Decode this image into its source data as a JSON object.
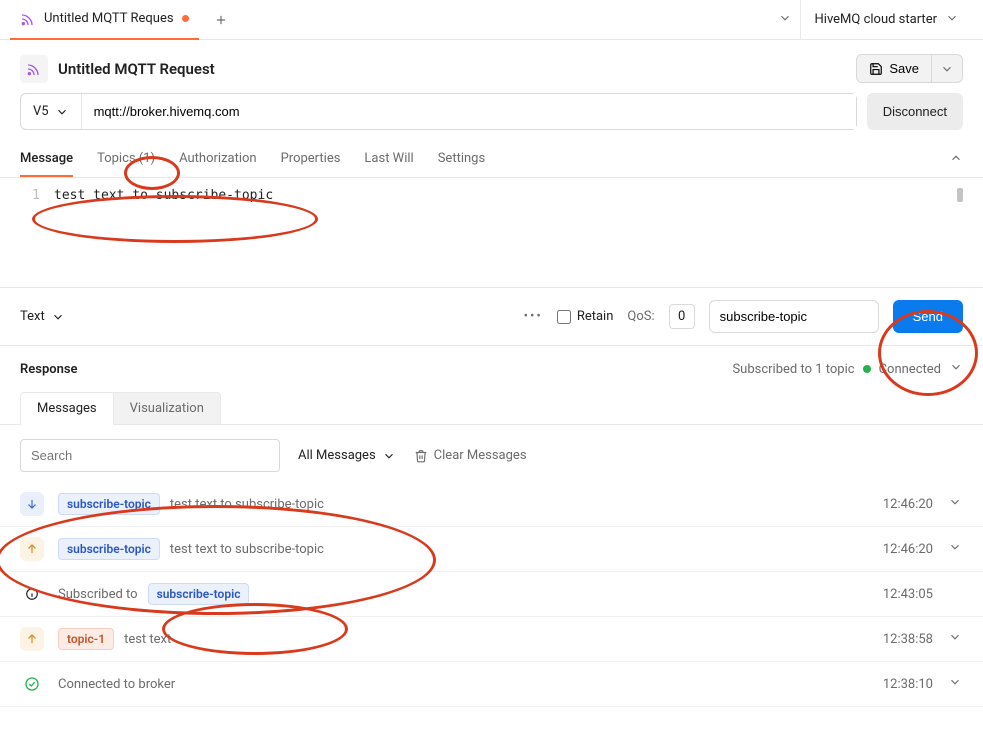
{
  "tabbar": {
    "tab_title": "Untitled MQTT Reques",
    "env_name": "HiveMQ cloud starter"
  },
  "request": {
    "title": "Untitled MQTT Request",
    "save_label": "Save",
    "version_label": "V5",
    "url": "mqtt://broker.hivemq.com",
    "disconnect_label": "Disconnect"
  },
  "req_tabs": {
    "message": "Message",
    "topics": "Topics (1)",
    "authorization": "Authorization",
    "properties": "Properties",
    "last_will": "Last Will",
    "settings": "Settings"
  },
  "editor": {
    "line_number": "1",
    "content": "test text to subscribe-topic"
  },
  "send_row": {
    "type_label": "Text",
    "retain_label": "Retain",
    "qos_label": "QoS:",
    "qos_value": "0",
    "topic_value": "subscribe-topic",
    "send_label": "Send"
  },
  "response": {
    "title": "Response",
    "sub_status": "Subscribed to 1 topic",
    "conn_label": "Connected"
  },
  "resp_tabs": {
    "messages": "Messages",
    "visualization": "Visualization"
  },
  "filter_row": {
    "search_placeholder": "Search",
    "filter_label": "All Messages",
    "clear_label": "Clear Messages"
  },
  "messages": [
    {
      "dir": "down",
      "topic": "subscribe-topic",
      "topic_style": "blue",
      "text": "test text to subscribe-topic",
      "time": "12:46:20",
      "expandable": true
    },
    {
      "dir": "up",
      "topic": "subscribe-topic",
      "topic_style": "blue",
      "text": "test text to subscribe-topic",
      "time": "12:46:20",
      "expandable": true
    },
    {
      "dir": "info",
      "prefix": "Subscribed to",
      "topic": "subscribe-topic",
      "topic_style": "blue",
      "text": "",
      "time": "12:43:05",
      "expandable": false
    },
    {
      "dir": "up",
      "topic": "topic-1",
      "topic_style": "orange",
      "text": "test text",
      "time": "12:38:58",
      "expandable": true
    },
    {
      "dir": "ok",
      "topic": "",
      "topic_style": "",
      "text": "Connected to broker",
      "time": "12:38:10",
      "expandable": true
    }
  ]
}
